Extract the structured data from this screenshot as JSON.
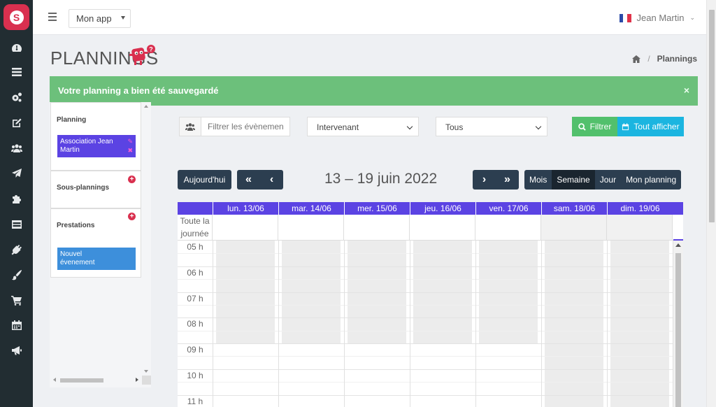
{
  "header": {
    "app_select": "Mon app",
    "user_name": "Jean Martin"
  },
  "page": {
    "title": "PLANNINGS",
    "breadcrumb_current": "Plannings"
  },
  "alert": {
    "message": "Votre planning a bien été sauvegardé",
    "close": "×"
  },
  "sidebar_icons": [
    "dashboard-icon",
    "list-icon",
    "cogs-icon",
    "edit-icon",
    "users-icon",
    "send-icon",
    "puzzle-icon",
    "table-icon",
    "plug-icon",
    "brush-icon",
    "cart-icon",
    "calendar-icon",
    "bullhorn-icon"
  ],
  "subpanel": {
    "planning_title": "Planning",
    "planning_item": "Association Jean Martin",
    "subplannings_title": "Sous-plannings",
    "prestations_title": "Prestations",
    "new_event": "Nouvel évenement",
    "colors": {
      "planning_chip": "#5b43e3",
      "new_event_chip": "#3d8fdb",
      "plus": "#d9304f"
    }
  },
  "filters": {
    "search_placeholder": "Filtrer les évènements",
    "intervenant_select": "Intervenant",
    "tous_select": "Tous",
    "filter_button": "Filtrer",
    "show_all_button": "Tout afficher"
  },
  "toolbar": {
    "today_button": "Aujourd'hui",
    "date_range": "13 – 19 juin 2022",
    "views": [
      "Mois",
      "Semaine",
      "Jour",
      "Mon planning"
    ],
    "active_view": "Semaine"
  },
  "calendar": {
    "days": [
      "lun. 13/06",
      "mar. 14/06",
      "mer. 15/06",
      "jeu. 16/06",
      "ven. 17/06",
      "sam. 18/06",
      "dim. 19/06"
    ],
    "allday_label": "Toute la journée",
    "hours": [
      "05 h",
      "06 h",
      "07 h",
      "08 h",
      "09 h",
      "10 h",
      "11 h"
    ],
    "header_color": "#5b43e3"
  }
}
